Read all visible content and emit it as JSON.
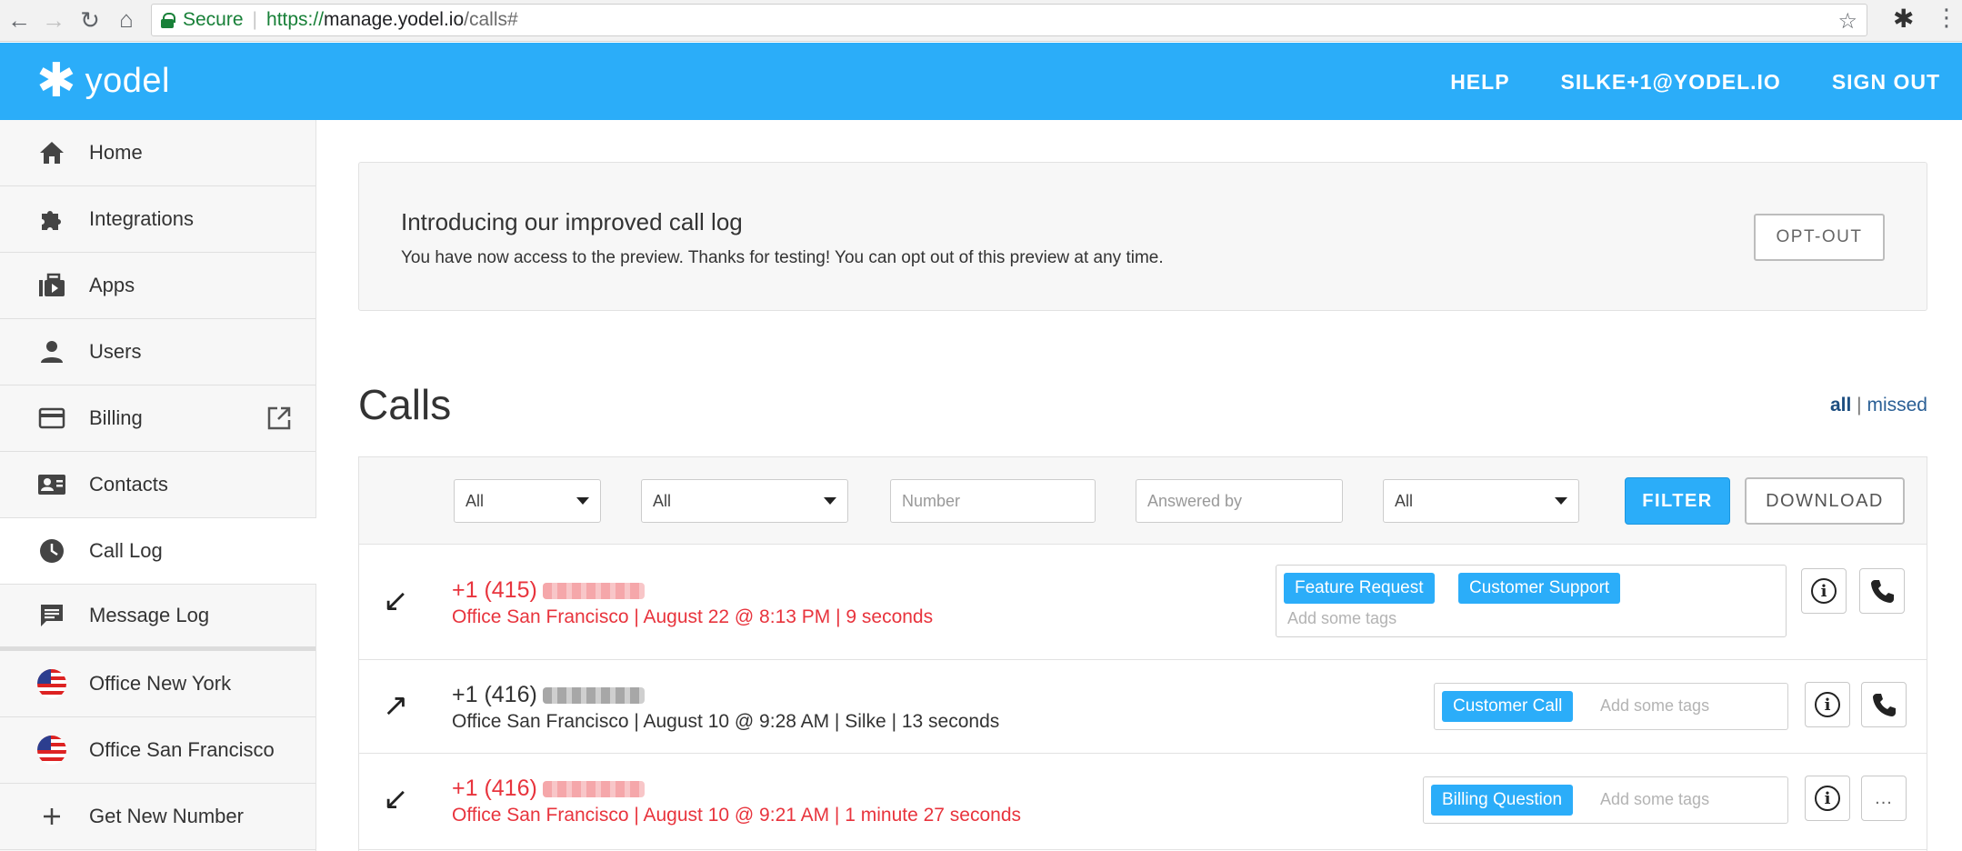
{
  "browser": {
    "secure_label": "Secure",
    "url_protocol": "https://",
    "url_host": "manage.yodel.io",
    "url_path": "/calls#"
  },
  "header": {
    "logo_text": "yodel",
    "help": "HELP",
    "account": "SILKE+1@YODEL.IO",
    "sign_out": "SIGN OUT"
  },
  "sidebar": {
    "items": [
      {
        "label": "Home",
        "icon": "home-icon"
      },
      {
        "label": "Integrations",
        "icon": "puzzle-icon"
      },
      {
        "label": "Apps",
        "icon": "apps-icon"
      },
      {
        "label": "Users",
        "icon": "user-icon"
      },
      {
        "label": "Billing",
        "icon": "credit-card-icon"
      },
      {
        "label": "Contacts",
        "icon": "contact-card-icon"
      },
      {
        "label": "Call Log",
        "icon": "clock-icon"
      },
      {
        "label": "Message Log",
        "icon": "message-icon"
      },
      {
        "label": "Office New York",
        "icon": "us-flag-icon"
      },
      {
        "label": "Office San Francisco",
        "icon": "us-flag-icon"
      },
      {
        "label": "Get New Number",
        "icon": "plus-icon"
      }
    ],
    "active": "Call Log"
  },
  "banner": {
    "title": "Introducing our improved call log",
    "text": "You have now access to the preview. Thanks for testing! You can opt out of this preview at any time.",
    "opt_out": "OPT-OUT"
  },
  "calls": {
    "title": "Calls",
    "view_all": "all",
    "view_sep": "|",
    "view_missed": "missed",
    "filters": {
      "select1": "All",
      "select2": "All",
      "number_placeholder": "Number",
      "answered_placeholder": "Answered by",
      "select3": "All",
      "filter_button": "FILTER",
      "download_button": "DOWNLOAD"
    },
    "rows": [
      {
        "direction": "incoming",
        "number": "+1 (415)",
        "meta": "Office San Francisco | August 22 @ 8:13 PM | 9 seconds",
        "missed": true,
        "tags": [
          "Feature Request",
          "Customer Support"
        ],
        "tag_placeholder": "Add some tags",
        "actions": [
          "info",
          "call"
        ]
      },
      {
        "direction": "outgoing",
        "number": "+1 (416)",
        "meta": "Office San Francisco | August 10 @ 9:28 AM | Silke | 13 seconds",
        "missed": false,
        "tags": [
          "Customer Call"
        ],
        "tag_placeholder": "Add some tags",
        "actions": [
          "info",
          "call"
        ]
      },
      {
        "direction": "incoming",
        "number": "+1 (416)",
        "meta": "Office San Francisco | August 10 @ 9:21 AM | 1 minute 27 seconds",
        "missed": true,
        "tags": [
          "Billing Question"
        ],
        "tag_placeholder": "Add some tags",
        "actions": [
          "info",
          "more"
        ],
        "more_label": "..."
      }
    ]
  },
  "colors": {
    "brand": "#2badf9",
    "missed": "#e8343d"
  }
}
